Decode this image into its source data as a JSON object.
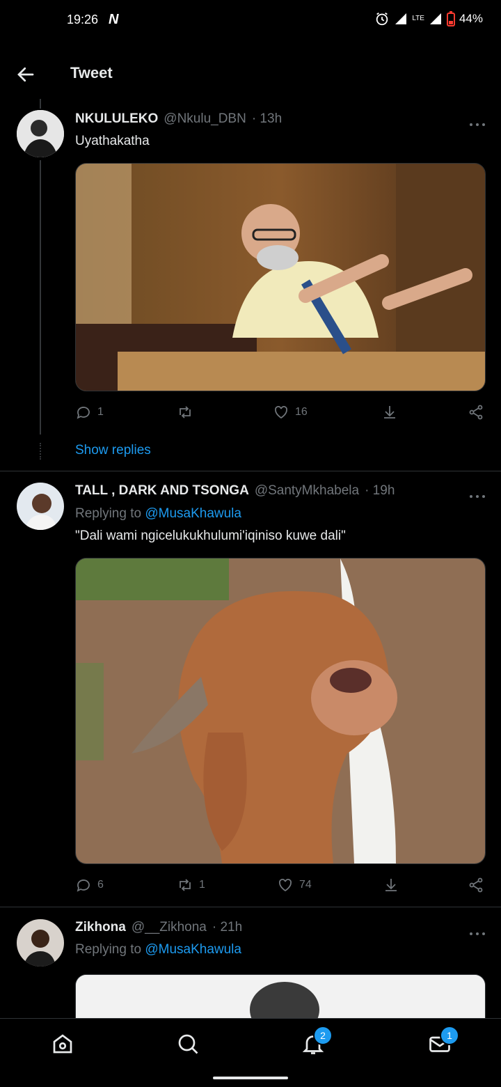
{
  "status_bar": {
    "time": "19:26",
    "network": "LTE",
    "battery": "44%"
  },
  "header": {
    "title": "Tweet"
  },
  "tweets": [
    {
      "name": "NKULULEKO",
      "handle": "@Nkulu_DBN",
      "time": "· 13h",
      "replying_to_prefix": "",
      "replying_to": "",
      "text": "Uyathakatha",
      "replies": "1",
      "retweets": "",
      "likes": "16"
    },
    {
      "name": "TALL , DARK AND TSONGA",
      "handle": "@SantyMkhabela",
      "time": "· 19h",
      "replying_to_prefix": "Replying to",
      "replying_to": "@MusaKhawula",
      "text": "\"Dali wami ngicelukukhulumi'iqiniso kuwe dali\"",
      "replies": "6",
      "retweets": "1",
      "likes": "74"
    },
    {
      "name": "Zikhona",
      "handle": "@__Zikhona",
      "time": "· 21h",
      "replying_to_prefix": "Replying to",
      "replying_to": "@MusaKhawula",
      "text": ""
    }
  ],
  "show_replies": "Show replies",
  "bottom_nav": {
    "notifications_badge": "2",
    "messages_badge": "1"
  },
  "colors": {
    "accent": "#1d9bf0",
    "background": "#000000",
    "muted": "#71767b"
  }
}
